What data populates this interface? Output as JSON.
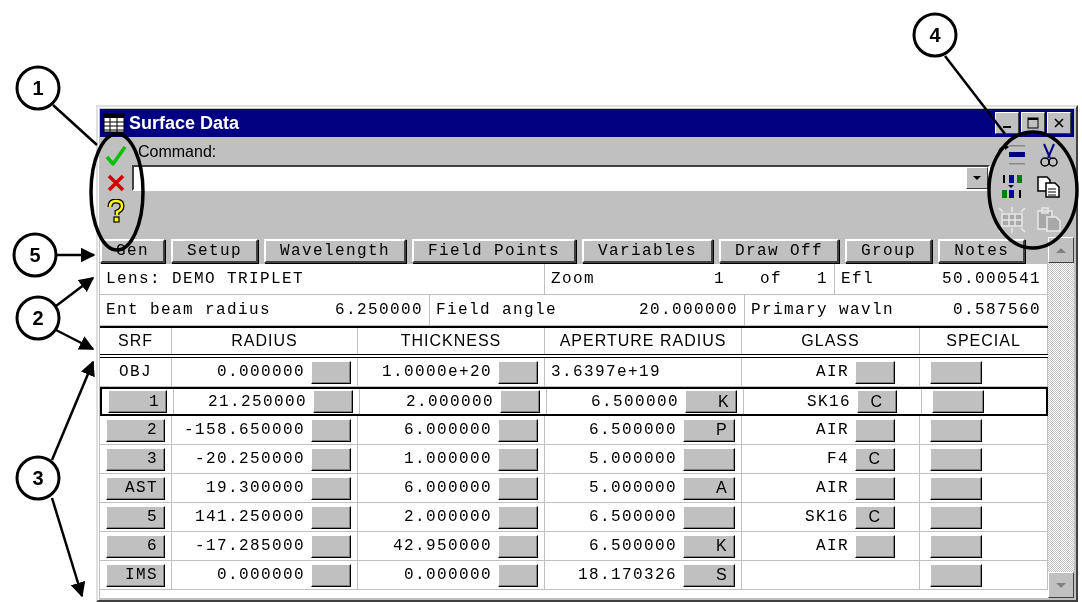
{
  "callouts": [
    "1",
    "2",
    "3",
    "4",
    "5"
  ],
  "window": {
    "title": "Surface Data"
  },
  "command": {
    "label": "Command:"
  },
  "command_buttons": [
    {
      "kind": "ok"
    },
    {
      "kind": "cancel"
    },
    {
      "kind": "help"
    }
  ],
  "toolbar_icons": [
    {
      "kind": "insert",
      "disabled": false
    },
    {
      "kind": "cut",
      "disabled": false
    },
    {
      "kind": "sort",
      "disabled": false
    },
    {
      "kind": "copy",
      "disabled": false
    },
    {
      "kind": "grid",
      "disabled": true
    },
    {
      "kind": "paste",
      "disabled": true
    }
  ],
  "button_bar": [
    "Gen",
    "Setup",
    "Wavelength",
    "Field Points",
    "Variables",
    "Draw Off",
    "Group",
    "Notes"
  ],
  "info_rows": [
    [
      {
        "label": "Lens: DEMO TRIPLET"
      },
      {
        "label": "Zoom",
        "value": "1 of 1"
      },
      {
        "label": "Efl",
        "value": "50.000541"
      }
    ],
    [
      {
        "label": "Ent beam radius",
        "value": "6.250000"
      },
      {
        "label": "Field angle",
        "value": "20.000000"
      },
      {
        "label": "Primary wavln",
        "value": "0.587560"
      }
    ]
  ],
  "table": {
    "columns": [
      "SRF",
      "RADIUS",
      "THICKNESS",
      "APERTURE RADIUS",
      "GLASS",
      "SPECIAL"
    ],
    "rows": [
      {
        "srf": "OBJ",
        "srf_button": false,
        "selected": false,
        "radius": "0.000000",
        "thickness": "1.0000e+20",
        "aperture": "3.6397e+19",
        "aperture_button": false,
        "glass": "AIR",
        "glass_button": true
      },
      {
        "srf": "1",
        "srf_button": true,
        "selected": true,
        "radius": "21.250000",
        "thickness": "2.000000",
        "aperture": "6.500000",
        "aperture_button": true,
        "aperture_solve": "K",
        "glass": "SK16",
        "glass_button": true,
        "glass_solve": "C"
      },
      {
        "srf": "2",
        "srf_button": true,
        "selected": false,
        "radius": "-158.650000",
        "thickness": "6.000000",
        "aperture": "6.500000",
        "aperture_button": true,
        "aperture_solve": "P",
        "glass": "AIR",
        "glass_button": true
      },
      {
        "srf": "3",
        "srf_button": true,
        "selected": false,
        "radius": "-20.250000",
        "thickness": "1.000000",
        "aperture": "5.000000",
        "aperture_button": true,
        "glass": "F4",
        "glass_button": true,
        "glass_solve": "C"
      },
      {
        "srf": "AST",
        "srf_button": true,
        "selected": false,
        "radius": "19.300000",
        "thickness": "6.000000",
        "aperture": "5.000000",
        "aperture_button": true,
        "aperture_solve": "A",
        "glass": "AIR",
        "glass_button": true
      },
      {
        "srf": "5",
        "srf_button": true,
        "selected": false,
        "radius": "141.250000",
        "thickness": "2.000000",
        "aperture": "6.500000",
        "aperture_button": true,
        "glass": "SK16",
        "glass_button": true,
        "glass_solve": "C"
      },
      {
        "srf": "6",
        "srf_button": true,
        "selected": false,
        "radius": "-17.285000",
        "thickness": "42.950000",
        "aperture": "6.500000",
        "aperture_button": true,
        "aperture_solve": "K",
        "glass": "AIR",
        "glass_button": true
      },
      {
        "srf": "IMS",
        "srf_button": true,
        "selected": false,
        "radius": "0.000000",
        "thickness": "0.000000",
        "aperture": "18.170326",
        "aperture_button": true,
        "aperture_solve": "S",
        "glass_button": false
      }
    ]
  }
}
